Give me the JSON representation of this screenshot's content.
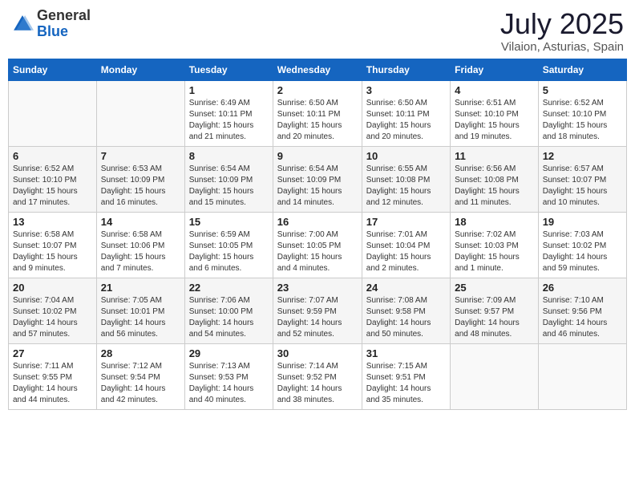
{
  "header": {
    "logo_general": "General",
    "logo_blue": "Blue",
    "title": "July 2025",
    "subtitle": "Vilaion, Asturias, Spain"
  },
  "weekdays": [
    "Sunday",
    "Monday",
    "Tuesday",
    "Wednesday",
    "Thursday",
    "Friday",
    "Saturday"
  ],
  "weeks": [
    [
      {
        "day": "",
        "sunrise": "",
        "sunset": "",
        "daylight": ""
      },
      {
        "day": "",
        "sunrise": "",
        "sunset": "",
        "daylight": ""
      },
      {
        "day": "1",
        "sunrise": "Sunrise: 6:49 AM",
        "sunset": "Sunset: 10:11 PM",
        "daylight": "Daylight: 15 hours and 21 minutes."
      },
      {
        "day": "2",
        "sunrise": "Sunrise: 6:50 AM",
        "sunset": "Sunset: 10:11 PM",
        "daylight": "Daylight: 15 hours and 20 minutes."
      },
      {
        "day": "3",
        "sunrise": "Sunrise: 6:50 AM",
        "sunset": "Sunset: 10:11 PM",
        "daylight": "Daylight: 15 hours and 20 minutes."
      },
      {
        "day": "4",
        "sunrise": "Sunrise: 6:51 AM",
        "sunset": "Sunset: 10:10 PM",
        "daylight": "Daylight: 15 hours and 19 minutes."
      },
      {
        "day": "5",
        "sunrise": "Sunrise: 6:52 AM",
        "sunset": "Sunset: 10:10 PM",
        "daylight": "Daylight: 15 hours and 18 minutes."
      }
    ],
    [
      {
        "day": "6",
        "sunrise": "Sunrise: 6:52 AM",
        "sunset": "Sunset: 10:10 PM",
        "daylight": "Daylight: 15 hours and 17 minutes."
      },
      {
        "day": "7",
        "sunrise": "Sunrise: 6:53 AM",
        "sunset": "Sunset: 10:09 PM",
        "daylight": "Daylight: 15 hours and 16 minutes."
      },
      {
        "day": "8",
        "sunrise": "Sunrise: 6:54 AM",
        "sunset": "Sunset: 10:09 PM",
        "daylight": "Daylight: 15 hours and 15 minutes."
      },
      {
        "day": "9",
        "sunrise": "Sunrise: 6:54 AM",
        "sunset": "Sunset: 10:09 PM",
        "daylight": "Daylight: 15 hours and 14 minutes."
      },
      {
        "day": "10",
        "sunrise": "Sunrise: 6:55 AM",
        "sunset": "Sunset: 10:08 PM",
        "daylight": "Daylight: 15 hours and 12 minutes."
      },
      {
        "day": "11",
        "sunrise": "Sunrise: 6:56 AM",
        "sunset": "Sunset: 10:08 PM",
        "daylight": "Daylight: 15 hours and 11 minutes."
      },
      {
        "day": "12",
        "sunrise": "Sunrise: 6:57 AM",
        "sunset": "Sunset: 10:07 PM",
        "daylight": "Daylight: 15 hours and 10 minutes."
      }
    ],
    [
      {
        "day": "13",
        "sunrise": "Sunrise: 6:58 AM",
        "sunset": "Sunset: 10:07 PM",
        "daylight": "Daylight: 15 hours and 9 minutes."
      },
      {
        "day": "14",
        "sunrise": "Sunrise: 6:58 AM",
        "sunset": "Sunset: 10:06 PM",
        "daylight": "Daylight: 15 hours and 7 minutes."
      },
      {
        "day": "15",
        "sunrise": "Sunrise: 6:59 AM",
        "sunset": "Sunset: 10:05 PM",
        "daylight": "Daylight: 15 hours and 6 minutes."
      },
      {
        "day": "16",
        "sunrise": "Sunrise: 7:00 AM",
        "sunset": "Sunset: 10:05 PM",
        "daylight": "Daylight: 15 hours and 4 minutes."
      },
      {
        "day": "17",
        "sunrise": "Sunrise: 7:01 AM",
        "sunset": "Sunset: 10:04 PM",
        "daylight": "Daylight: 15 hours and 2 minutes."
      },
      {
        "day": "18",
        "sunrise": "Sunrise: 7:02 AM",
        "sunset": "Sunset: 10:03 PM",
        "daylight": "Daylight: 15 hours and 1 minute."
      },
      {
        "day": "19",
        "sunrise": "Sunrise: 7:03 AM",
        "sunset": "Sunset: 10:02 PM",
        "daylight": "Daylight: 14 hours and 59 minutes."
      }
    ],
    [
      {
        "day": "20",
        "sunrise": "Sunrise: 7:04 AM",
        "sunset": "Sunset: 10:02 PM",
        "daylight": "Daylight: 14 hours and 57 minutes."
      },
      {
        "day": "21",
        "sunrise": "Sunrise: 7:05 AM",
        "sunset": "Sunset: 10:01 PM",
        "daylight": "Daylight: 14 hours and 56 minutes."
      },
      {
        "day": "22",
        "sunrise": "Sunrise: 7:06 AM",
        "sunset": "Sunset: 10:00 PM",
        "daylight": "Daylight: 14 hours and 54 minutes."
      },
      {
        "day": "23",
        "sunrise": "Sunrise: 7:07 AM",
        "sunset": "Sunset: 9:59 PM",
        "daylight": "Daylight: 14 hours and 52 minutes."
      },
      {
        "day": "24",
        "sunrise": "Sunrise: 7:08 AM",
        "sunset": "Sunset: 9:58 PM",
        "daylight": "Daylight: 14 hours and 50 minutes."
      },
      {
        "day": "25",
        "sunrise": "Sunrise: 7:09 AM",
        "sunset": "Sunset: 9:57 PM",
        "daylight": "Daylight: 14 hours and 48 minutes."
      },
      {
        "day": "26",
        "sunrise": "Sunrise: 7:10 AM",
        "sunset": "Sunset: 9:56 PM",
        "daylight": "Daylight: 14 hours and 46 minutes."
      }
    ],
    [
      {
        "day": "27",
        "sunrise": "Sunrise: 7:11 AM",
        "sunset": "Sunset: 9:55 PM",
        "daylight": "Daylight: 14 hours and 44 minutes."
      },
      {
        "day": "28",
        "sunrise": "Sunrise: 7:12 AM",
        "sunset": "Sunset: 9:54 PM",
        "daylight": "Daylight: 14 hours and 42 minutes."
      },
      {
        "day": "29",
        "sunrise": "Sunrise: 7:13 AM",
        "sunset": "Sunset: 9:53 PM",
        "daylight": "Daylight: 14 hours and 40 minutes."
      },
      {
        "day": "30",
        "sunrise": "Sunrise: 7:14 AM",
        "sunset": "Sunset: 9:52 PM",
        "daylight": "Daylight: 14 hours and 38 minutes."
      },
      {
        "day": "31",
        "sunrise": "Sunrise: 7:15 AM",
        "sunset": "Sunset: 9:51 PM",
        "daylight": "Daylight: 14 hours and 35 minutes."
      },
      {
        "day": "",
        "sunrise": "",
        "sunset": "",
        "daylight": ""
      },
      {
        "day": "",
        "sunrise": "",
        "sunset": "",
        "daylight": ""
      }
    ]
  ]
}
